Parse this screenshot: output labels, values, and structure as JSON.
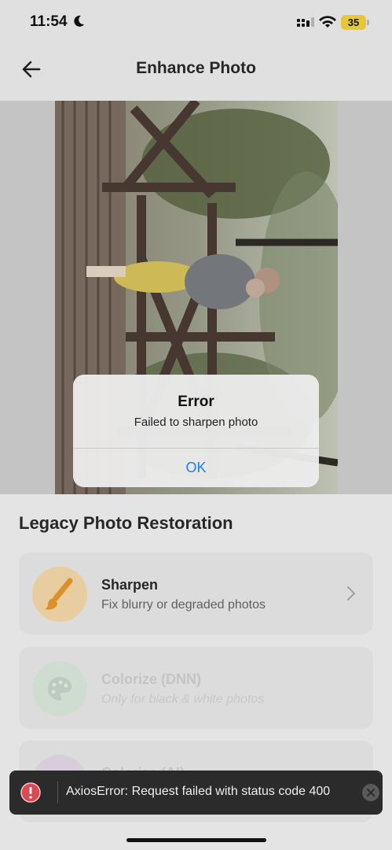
{
  "status_bar": {
    "time": "11:54",
    "battery": "35"
  },
  "header": {
    "title": "Enhance Photo",
    "back_icon": "arrow-left-icon"
  },
  "section": {
    "title": "Legacy Photo Restoration"
  },
  "options": [
    {
      "title": "Sharpen",
      "subtitle": "Fix blurry or degraded photos",
      "icon": "paintbrush-icon",
      "color": "#f1a93a"
    },
    {
      "title": "Colorize (DNN)",
      "subtitle": "Only for black & white photos",
      "icon": "palette-icon",
      "color": "#bfe5c6"
    },
    {
      "title": "Colorize (AI)"
    }
  ],
  "alert": {
    "title": "Error",
    "message": "Failed to sharpen photo",
    "ok_label": "OK"
  },
  "toast": {
    "message": "AxiosError: Request failed with status code 400",
    "icon": "error-icon",
    "color": "#d94a55"
  },
  "colors": {
    "accent": "#1a7ff0",
    "toast_bg": "#2b2b2b"
  }
}
